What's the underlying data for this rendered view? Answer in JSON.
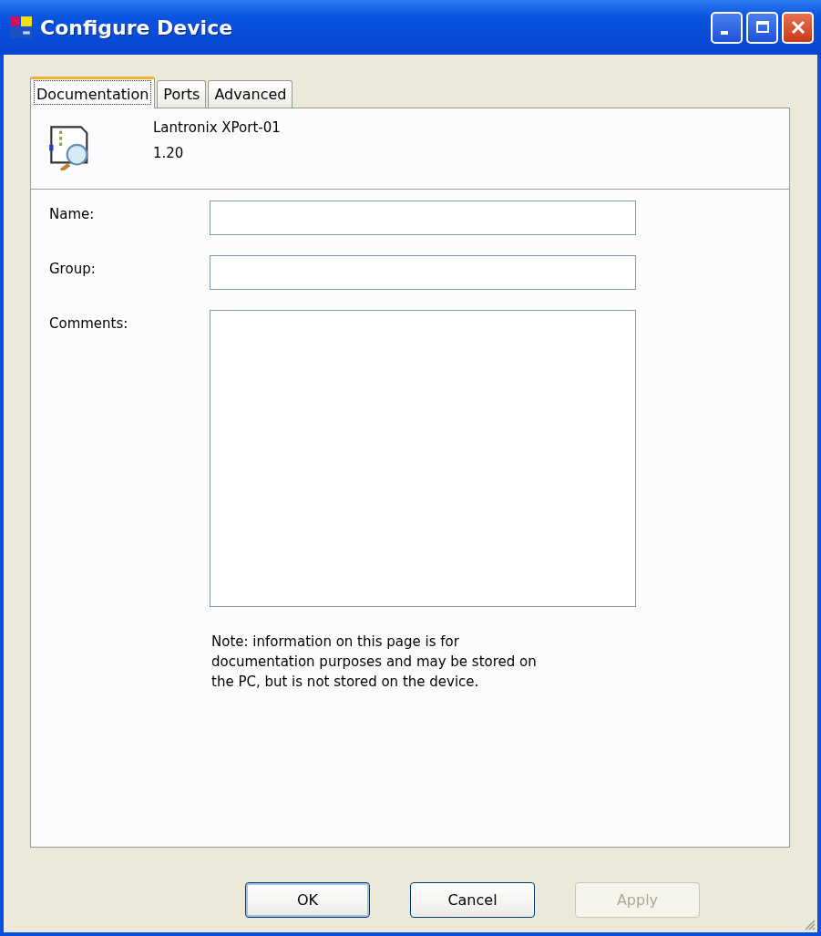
{
  "window": {
    "title": "Configure Device"
  },
  "tabs": [
    {
      "label": "Documentation",
      "selected": true
    },
    {
      "label": "Ports",
      "selected": false
    },
    {
      "label": "Advanced",
      "selected": false
    }
  ],
  "device": {
    "name": "Lantronix XPort-01",
    "version": "1.20"
  },
  "fields": [
    {
      "label": "Name:",
      "kind": "line"
    },
    {
      "label": "Group:",
      "kind": "line"
    },
    {
      "label": "Comments:",
      "kind": "multiline"
    }
  ],
  "note": "Note: information on this page is for documentation purposes and may be stored on the PC, but is not stored on the device.",
  "buttons": [
    {
      "label": "OK",
      "default": true,
      "disabled": false
    },
    {
      "label": "Cancel",
      "default": false,
      "disabled": false
    },
    {
      "label": "Apply",
      "default": false,
      "disabled": true
    }
  ]
}
